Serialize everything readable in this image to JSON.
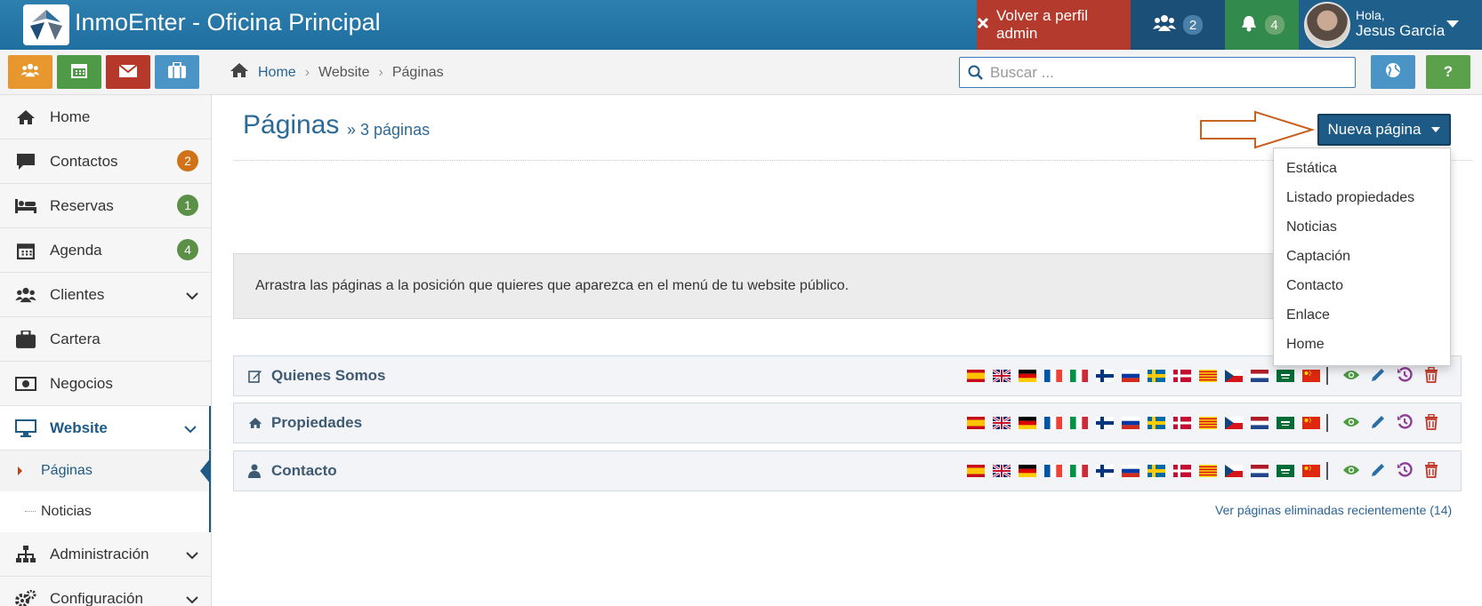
{
  "app": {
    "title": "InmoEnter - Oficina Principal"
  },
  "topbar": {
    "admin_button": "Volver a perfil admin",
    "users_count": "2",
    "notifications_count": "4",
    "greeting": "Hola,",
    "user_name": "Jesus García"
  },
  "quick_buttons": [
    {
      "icon": "users-icon",
      "color": "#e8962e"
    },
    {
      "icon": "calendar-icon",
      "color": "#4f9a46"
    },
    {
      "icon": "envelope-icon",
      "color": "#b5382b"
    },
    {
      "icon": "briefcase-icon",
      "color": "#4a94c6"
    }
  ],
  "breadcrumb": {
    "home": "Home",
    "level1": "Website",
    "level2": "Páginas"
  },
  "search": {
    "placeholder": "Buscar ..."
  },
  "help_label": "?",
  "sidebar": {
    "items": [
      {
        "label": "Home"
      },
      {
        "label": "Contactos",
        "badge": "2",
        "badge_color": "#d07318"
      },
      {
        "label": "Reservas",
        "badge": "1",
        "badge_color": "#5b9146"
      },
      {
        "label": "Agenda",
        "badge": "4",
        "badge_color": "#5b9146"
      },
      {
        "label": "Clientes"
      },
      {
        "label": "Cartera"
      },
      {
        "label": "Negocios"
      },
      {
        "label": "Website"
      },
      {
        "label": "Administración"
      },
      {
        "label": "Configuración"
      }
    ],
    "website_sub": [
      {
        "label": "Páginas"
      },
      {
        "label": "Noticias"
      }
    ]
  },
  "main": {
    "title": "Páginas",
    "subtitle": "» 3 páginas",
    "new_button": "Nueva página",
    "dropdown": [
      "Estática",
      "Listado propiedades",
      "Noticias",
      "Captación",
      "Contacto",
      "Enlace",
      "Home"
    ],
    "info": "Arrastra las páginas a la posición que quieres que aparezca en el menú de tu website público.",
    "pages": [
      {
        "name": "Quienes Somos",
        "icon": "edit-icon"
      },
      {
        "name": "Propiedades",
        "icon": "home-icon"
      },
      {
        "name": "Contacto",
        "icon": "user-icon"
      }
    ],
    "flags": [
      "es",
      "gb",
      "de",
      "fr",
      "it",
      "fi",
      "ru",
      "se",
      "dk",
      "cat",
      "cz",
      "nl",
      "sa",
      "cn"
    ],
    "deleted_link": "Ver páginas eliminadas recientemente (14)"
  },
  "colors": {
    "brand": "#1e5a86",
    "topbar": "#2d7fae",
    "admin_red": "#b33a2c",
    "annotation_arrow": "#c8601e"
  }
}
